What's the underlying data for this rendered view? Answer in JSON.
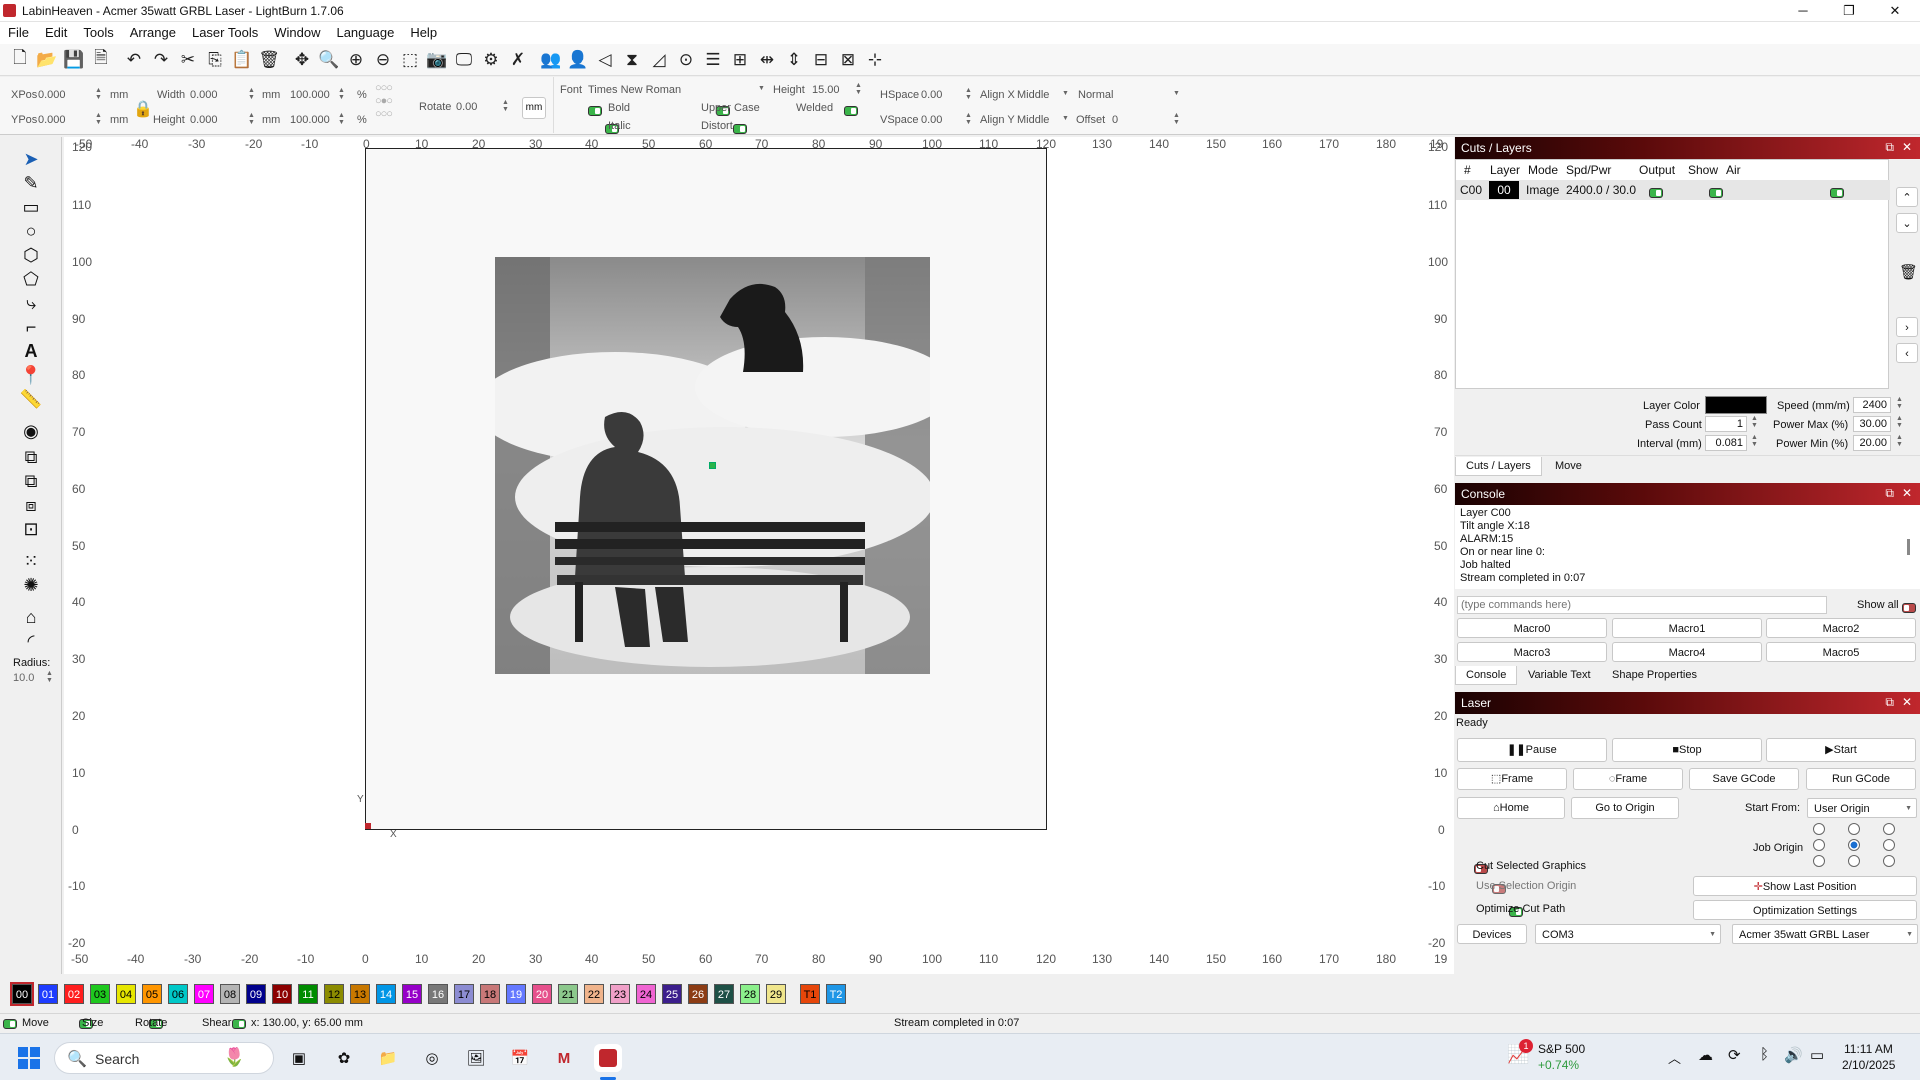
{
  "window": {
    "title": "LabinHeaven - Acmer 35watt GRBL Laser - LightBurn 1.7.06",
    "minimize": "─",
    "maximize": "❐",
    "close": "✕"
  },
  "menu": [
    "File",
    "Edit",
    "Tools",
    "Arrange",
    "Laser Tools",
    "Window",
    "Language",
    "Help"
  ],
  "toolbar_icons": [
    "new-file",
    "open-folder",
    "save",
    "save-as",
    "undo",
    "redo",
    "cut",
    "copy",
    "paste",
    "delete",
    "move",
    "zoom-to-page",
    "zoom-in",
    "zoom-out",
    "zoom-selection",
    "camera",
    "frame-screen",
    "settings-gear",
    "tools-wrench",
    "group",
    "user",
    "flip-h",
    "mirror",
    "rotate",
    "center-target",
    "align-stack",
    "distribute",
    "align-h",
    "align-v",
    "push-h",
    "push-v",
    "dock-center"
  ],
  "props": {
    "xpos_label": "XPos",
    "xpos": "0.000",
    "ypos_label": "YPos",
    "ypos": "0.000",
    "unit": "mm",
    "width_label": "Width",
    "width": "0.000",
    "height_label": "Height",
    "height": "0.000",
    "pct_w": "100.000",
    "pct_h": "100.000",
    "pct": "%",
    "rotate_label": "Rotate",
    "rotate": "0.00",
    "mm_btn": "mm",
    "font_label": "Font",
    "font": "Times New Roman",
    "fheight_label": "Height",
    "fheight": "15.00",
    "hspace_label": "HSpace",
    "hspace": "0.00",
    "vspace_label": "VSpace",
    "vspace": "0.00",
    "alignx_label": "Align X",
    "alignx": "Middle",
    "aligny_label": "Align Y",
    "aligny": "Middle",
    "normal": "Normal",
    "offset_label": "Offset",
    "offset": "0",
    "bold": "Bold",
    "italic": "Italic",
    "upper": "Upper Case",
    "distort": "Distort",
    "welded": "Welded"
  },
  "left_tools": [
    "select-arrow",
    "pen",
    "rectangle",
    "ellipse",
    "polygon",
    "pentagon",
    "edit-nodes",
    "measure-box",
    "text",
    "position-marker",
    "ruler",
    "lens",
    "clone",
    "copy-along",
    "offset",
    "boolean",
    "grid-array",
    "circular-array",
    "tab",
    "corner"
  ],
  "radius": {
    "label": "Radius:",
    "value": "10.0"
  },
  "rulers": {
    "top": [
      "-50",
      "-40",
      "-30",
      "-20",
      "-10",
      "0",
      "10",
      "20",
      "30",
      "40",
      "50",
      "60",
      "70",
      "80",
      "90",
      "100",
      "110",
      "120",
      "130",
      "140",
      "150",
      "160",
      "170",
      "180",
      "19"
    ],
    "left": [
      "120",
      "110",
      "100",
      "90",
      "80",
      "70",
      "60",
      "50",
      "40",
      "30",
      "20",
      "10",
      "0",
      "-10",
      "-20"
    ],
    "axis_x": "X",
    "axis_y": "Y"
  },
  "cuts": {
    "title": "Cuts / Layers",
    "headers": [
      "#",
      "Layer",
      "Mode",
      "Spd/Pwr",
      "Output",
      "Show",
      "Air"
    ],
    "row": {
      "id": "C00",
      "layer": "00",
      "mode": "Image",
      "spdpwr": "2400.0 / 30.0"
    },
    "layer_color_label": "Layer Color",
    "layer_color": "#000000",
    "speed_label": "Speed (mm/m)",
    "speed": "2400",
    "pass_label": "Pass Count",
    "pass": "1",
    "pmax_label": "Power Max (%)",
    "pmax": "30.00",
    "interval_label": "Interval (mm)",
    "interval": "0.081",
    "pmin_label": "Power Min (%)",
    "pmin": "20.00",
    "tabs": [
      "Cuts / Layers",
      "Move"
    ]
  },
  "console": {
    "title": "Console",
    "lines": [
      "Layer C00",
      "Tilt angle X:18",
      "ALARM:15",
      "On or near line 0:",
      "Job halted",
      "Stream completed in 0:07"
    ],
    "placeholder": "(type commands here)",
    "show_all": "Show all",
    "macros": [
      "Macro0",
      "Macro1",
      "Macro2",
      "Macro3",
      "Macro4",
      "Macro5"
    ],
    "tabs": [
      "Console",
      "Variable Text",
      "Shape Properties"
    ]
  },
  "laser": {
    "title": "Laser",
    "status": "Ready",
    "pause": "Pause",
    "stop": "Stop",
    "start": "Start",
    "frame1": "Frame",
    "frame2": "Frame",
    "save_gcode": "Save GCode",
    "run_gcode": "Run GCode",
    "home": "Home",
    "go_origin": "Go to Origin",
    "start_from_label": "Start From:",
    "start_from": "User Origin",
    "job_origin": "Job Origin",
    "cut_selected": "Cut Selected Graphics",
    "use_selection": "Use Selection Origin",
    "optimize": "Optimize Cut Path",
    "show_last": "Show Last Position",
    "opt_settings": "Optimization Settings",
    "devices": "Devices",
    "port": "COM3",
    "device": "Acmer 35watt GRBL Laser"
  },
  "palette": [
    {
      "n": "00",
      "c": "#000000",
      "t": "#fff"
    },
    {
      "n": "01",
      "c": "#1e3cff",
      "t": "#fff"
    },
    {
      "n": "02",
      "c": "#ff1e1e",
      "t": "#fff"
    },
    {
      "n": "03",
      "c": "#1ec81e",
      "t": "#000"
    },
    {
      "n": "04",
      "c": "#e6e600",
      "t": "#000"
    },
    {
      "n": "05",
      "c": "#ff9600",
      "t": "#000"
    },
    {
      "n": "06",
      "c": "#00c8c8",
      "t": "#000"
    },
    {
      "n": "07",
      "c": "#ff00ff",
      "t": "#fff"
    },
    {
      "n": "08",
      "c": "#b4b4b4",
      "t": "#000"
    },
    {
      "n": "09",
      "c": "#00008c",
      "t": "#fff"
    },
    {
      "n": "10",
      "c": "#8c0000",
      "t": "#fff"
    },
    {
      "n": "11",
      "c": "#008c00",
      "t": "#fff"
    },
    {
      "n": "12",
      "c": "#8c8c00",
      "t": "#000"
    },
    {
      "n": "13",
      "c": "#c87800",
      "t": "#000"
    },
    {
      "n": "14",
      "c": "#0096e6",
      "t": "#fff"
    },
    {
      "n": "15",
      "c": "#9600c8",
      "t": "#fff"
    },
    {
      "n": "16",
      "c": "#787878",
      "t": "#fff"
    },
    {
      "n": "17",
      "c": "#8c8cd2",
      "t": "#000"
    },
    {
      "n": "18",
      "c": "#c87878",
      "t": "#000"
    },
    {
      "n": "19",
      "c": "#6478ff",
      "t": "#fff"
    },
    {
      "n": "20",
      "c": "#e6508c",
      "t": "#fff"
    },
    {
      "n": "21",
      "c": "#8cc88c",
      "t": "#000"
    },
    {
      "n": "22",
      "c": "#f0b48c",
      "t": "#000"
    },
    {
      "n": "23",
      "c": "#f0a0c8",
      "t": "#000"
    },
    {
      "n": "24",
      "c": "#f064d2",
      "t": "#000"
    },
    {
      "n": "25",
      "c": "#3c1e8c",
      "t": "#fff"
    },
    {
      "n": "26",
      "c": "#8c3c14",
      "t": "#fff"
    },
    {
      "n": "27",
      "c": "#1e5046",
      "t": "#fff"
    },
    {
      "n": "28",
      "c": "#8cf08c",
      "t": "#000"
    },
    {
      "n": "29",
      "c": "#f0e68c",
      "t": "#000"
    },
    {
      "n": "T1",
      "c": "#e6460a",
      "t": "#000"
    },
    {
      "n": "T2",
      "c": "#1e96e6",
      "t": "#fff"
    }
  ],
  "status": {
    "move": "Move",
    "size": "Size",
    "rotate": "Rotate",
    "shear": "Shear",
    "coords": "x: 130.00, y: 65.00 mm",
    "message": "Stream completed in 0:07"
  },
  "taskbar": {
    "search": "Search",
    "stock_name": "S&P 500",
    "stock_change": "+0.74%",
    "badge": "1",
    "time": "11:11 AM",
    "date": "2/10/2025"
  }
}
